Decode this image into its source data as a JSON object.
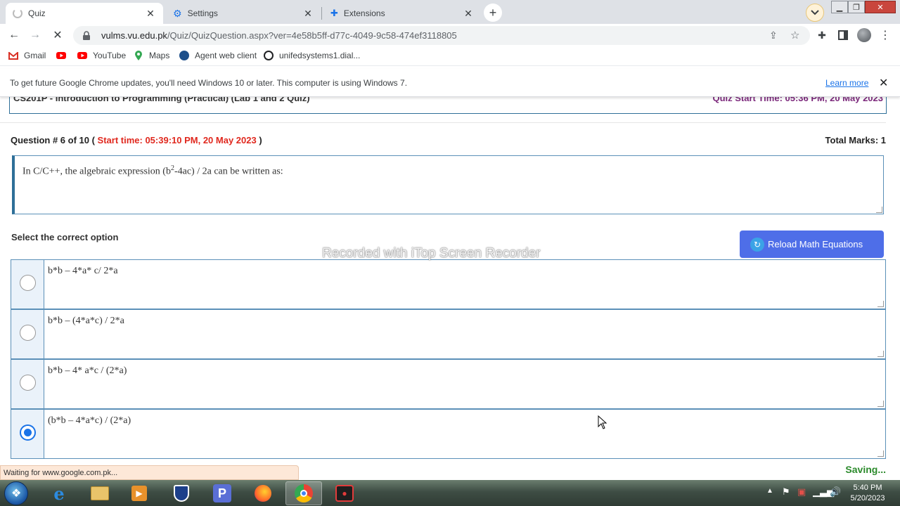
{
  "browser": {
    "tabs": [
      {
        "title": "Quiz",
        "active": true
      },
      {
        "title": "Settings",
        "active": false
      },
      {
        "title": "Extensions",
        "active": false
      }
    ],
    "url_host": "vulms.vu.edu.pk",
    "url_path": "/Quiz/QuizQuestion.aspx?ver=4e58b5ff-d77c-4049-9c58-474ef3118805",
    "bookmarks": [
      "Gmail",
      "",
      "YouTube",
      "Maps",
      "Agent web client",
      "unifedsystems1.dial..."
    ],
    "infobar_message": "To get future Google Chrome updates, you'll need Windows 10 or later. This computer is using Windows 7.",
    "infobar_link": "Learn more",
    "status_text": "Waiting for www.google.com.pk..."
  },
  "quiz": {
    "course": "CS201P - Introduction to Programming (Practical) (Lab 1 and 2 Quiz)",
    "quiz_start": "Quiz Start Time: 05:36 PM, 20 May 2023",
    "question_label": "Question # 6 of 10 (",
    "question_start": "Start time: 05:39:10 PM, 20 May 2023",
    "question_close": ")",
    "total_marks": "Total Marks: 1",
    "question_prefix": "In C/C++, the algebraic expression (b",
    "question_sup": "2",
    "question_suffix": "-4ac) / 2a can be written as:",
    "select_label": "Select the correct option",
    "reload_button": "Reload Math Equations",
    "options": [
      {
        "text": "b*b – 4*a* c/ 2*a",
        "selected": false
      },
      {
        "text": "b*b – (4*a*c) / 2*a",
        "selected": false
      },
      {
        "text": "b*b – 4* a*c / (2*a)",
        "selected": false
      },
      {
        "text": "(b*b – 4*a*c) / (2*a)",
        "selected": true
      }
    ],
    "saving": "Saving..."
  },
  "watermark": "Recorded with iTop Screen Recorder",
  "taskbar": {
    "time": "5:40 PM",
    "date": "5/20/2023"
  },
  "colors": {
    "accent_blue": "#1a73e8",
    "quiz_start": "#7d2a7d",
    "question_start": "#e0281e",
    "reload_button": "#4e6ee8",
    "saving": "#2b8a2b"
  }
}
